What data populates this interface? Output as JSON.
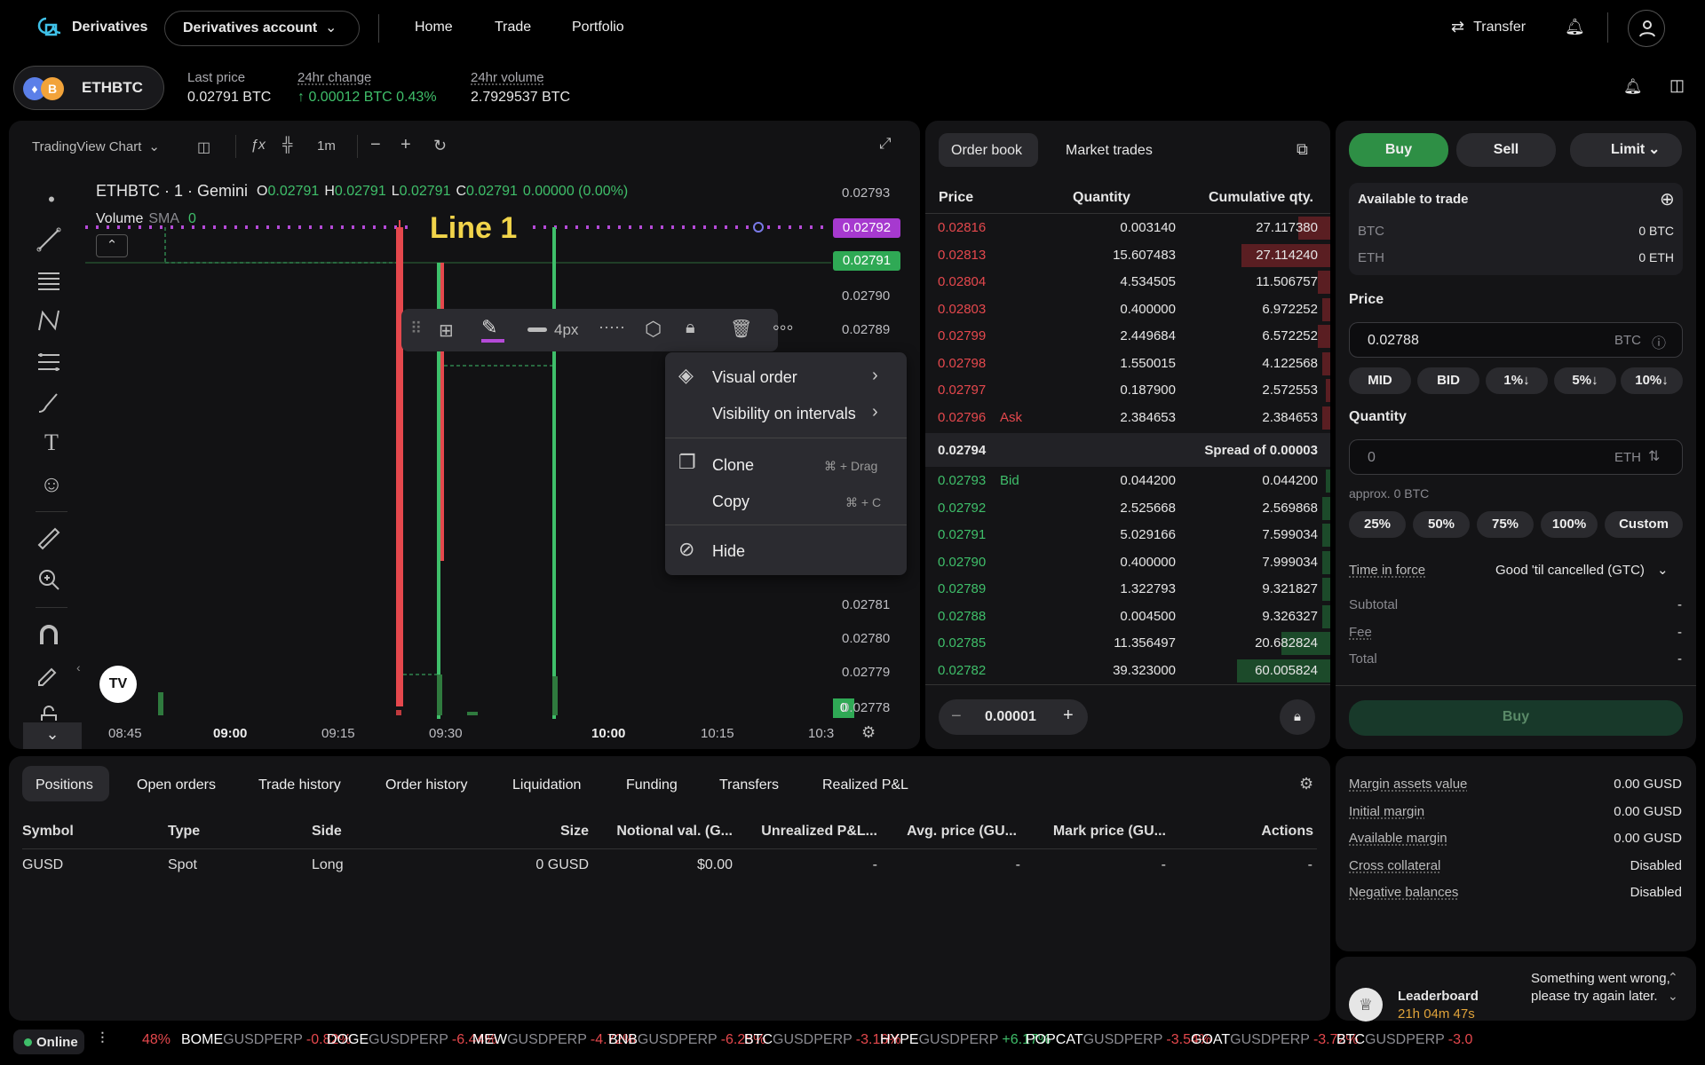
{
  "nav": {
    "brand": "Derivatives",
    "account": "Derivatives account",
    "links": [
      "Home",
      "Trade",
      "Portfolio"
    ],
    "transfer": "Transfer"
  },
  "pair": {
    "symbol": "ETHBTC",
    "last_label": "Last price",
    "last": "0.02791 BTC",
    "chg_label": "24hr change",
    "chg": "↑ 0.00012 BTC 0.43%",
    "vol_label": "24hr volume",
    "vol": "2.7929537 BTC"
  },
  "chart": {
    "toolbar": {
      "chart": "TradingView Chart",
      "interval": "1m"
    },
    "legend": {
      "title": "ETHBTC · 1 · Gemini",
      "O": "0.02791",
      "H": "0.02791",
      "L": "0.02791",
      "C": "0.02791",
      "chg": "0.00000 (0.00%)",
      "volume": "Volume",
      "sma": "SMA",
      "sma_v": "0"
    },
    "line_label": "Line 1",
    "width_label": "4px",
    "prices": [
      "0.02793",
      "0.02792",
      "0.02791",
      "0.02790",
      "0.02789",
      "0.02781",
      "0.02780",
      "0.02779",
      "0.02778"
    ],
    "badge_vol": "0",
    "times": [
      "08:45",
      "09:00",
      "09:15",
      "09:30",
      "10:00",
      "10:15",
      "10:3"
    ],
    "menu": {
      "visual": "Visual order",
      "visibility": "Visibility on intervals",
      "clone": "Clone",
      "clone_sc": "⌘ + Drag",
      "copy": "Copy",
      "copy_sc": "⌘ + C",
      "hide": "Hide"
    },
    "logo": "TV"
  },
  "orderbook": {
    "tabs": [
      "Order book",
      "Market trades"
    ],
    "headers": [
      "Price",
      "Quantity",
      "Cumulative qty."
    ],
    "asks": [
      [
        "0.02816",
        "0.003140",
        "27.117380",
        0.08
      ],
      [
        "0.02813",
        "15.607483",
        "27.114240",
        0.22
      ],
      [
        "0.02804",
        "4.534505",
        "11.506757",
        0.03
      ],
      [
        "0.02803",
        "0.400000",
        "6.972252",
        0.02
      ],
      [
        "0.02799",
        "2.449684",
        "6.572252",
        0.03
      ],
      [
        "0.02798",
        "1.550015",
        "4.122568",
        0.02
      ],
      [
        "0.02797",
        "0.187900",
        "2.572553",
        0.01
      ],
      [
        "0.02796",
        "2.384653",
        "2.384653",
        0.02
      ]
    ],
    "ask_tag": "Ask",
    "mid": "0.02794",
    "spread": "Spread of 0.00003",
    "bid_tag": "Bid",
    "bids": [
      [
        "0.02793",
        "0.044200",
        "0.044200",
        0.01
      ],
      [
        "0.02792",
        "2.525668",
        "2.569868",
        0.02
      ],
      [
        "0.02791",
        "5.029166",
        "7.599034",
        0.02
      ],
      [
        "0.02790",
        "0.400000",
        "7.999034",
        0.02
      ],
      [
        "0.02789",
        "1.322793",
        "9.321827",
        0.02
      ],
      [
        "0.02788",
        "0.004500",
        "9.326327",
        0.02
      ],
      [
        "0.02785",
        "11.356497",
        "20.682824",
        0.12
      ],
      [
        "0.02782",
        "39.323000",
        "60.005824",
        0.23
      ]
    ],
    "step": "0.00001"
  },
  "trade": {
    "buy": "Buy",
    "sell": "Sell",
    "type": "Limit",
    "avail": "Available to trade",
    "btc": "BTC",
    "btc_v": "0 BTC",
    "eth": "ETH",
    "eth_v": "0 ETH",
    "price_label": "Price",
    "price": "0.02788",
    "price_unit": "BTC",
    "pbtns": [
      "MID",
      "BID",
      "1%↓",
      "5%↓",
      "10%↓"
    ],
    "qty_label": "Quantity",
    "qty_ph": "0",
    "qty_unit": "ETH",
    "approx": "approx. 0 BTC",
    "qbtns": [
      "25%",
      "50%",
      "75%",
      "100%",
      "Custom"
    ],
    "tif_label": "Time in force",
    "tif": "Good 'til cancelled (GTC)",
    "subtotal": "Subtotal",
    "fee": "Fee",
    "total": "Total",
    "dash": "-",
    "submit": "Buy"
  },
  "positions": {
    "tabs": [
      "Positions",
      "Open orders",
      "Trade history",
      "Order history",
      "Liquidation",
      "Funding",
      "Transfers",
      "Realized P&L"
    ],
    "headers": [
      "Symbol",
      "Type",
      "Side",
      "Size",
      "Notional val. (G...",
      "Unrealized P&L...",
      "Avg. price (GU...",
      "Mark price (GU...",
      "Actions"
    ],
    "row": [
      "GUSD",
      "Spot",
      "Long",
      "0 GUSD",
      "$0.00",
      "-",
      "-",
      "-",
      "-"
    ]
  },
  "margin": {
    "items": [
      [
        "Margin assets value",
        "0.00 GUSD"
      ],
      [
        "Initial margin",
        "0.00 GUSD"
      ],
      [
        "Available margin",
        "0.00 GUSD"
      ],
      [
        "Cross collateral",
        "Disabled"
      ],
      [
        "Negative balances",
        "Disabled"
      ]
    ]
  },
  "leaderboard": {
    "title": "Leaderboard",
    "timer": "21h 04m 47s",
    "msg": "Something went wrong, please try again later."
  },
  "status": {
    "online": "Online",
    "ticker": [
      [
        "",
        "48%",
        "r"
      ],
      [
        "BOME",
        "-0.82%",
        "r"
      ],
      [
        "DOGE",
        "-6.44%",
        "r"
      ],
      [
        "MEW",
        "-4.72%",
        "r"
      ],
      [
        "BNB",
        "-6.25%",
        "r"
      ],
      [
        "BTC",
        "-3.16%",
        "r"
      ],
      [
        "HYPE",
        "+6.17%",
        "g"
      ],
      [
        "POPCAT",
        "-3.54%",
        "r"
      ],
      [
        "GOAT",
        "-3.72%",
        "r"
      ],
      [
        "BTC",
        "-3.0",
        "r"
      ]
    ],
    "suffix": "GUSDPERP"
  }
}
